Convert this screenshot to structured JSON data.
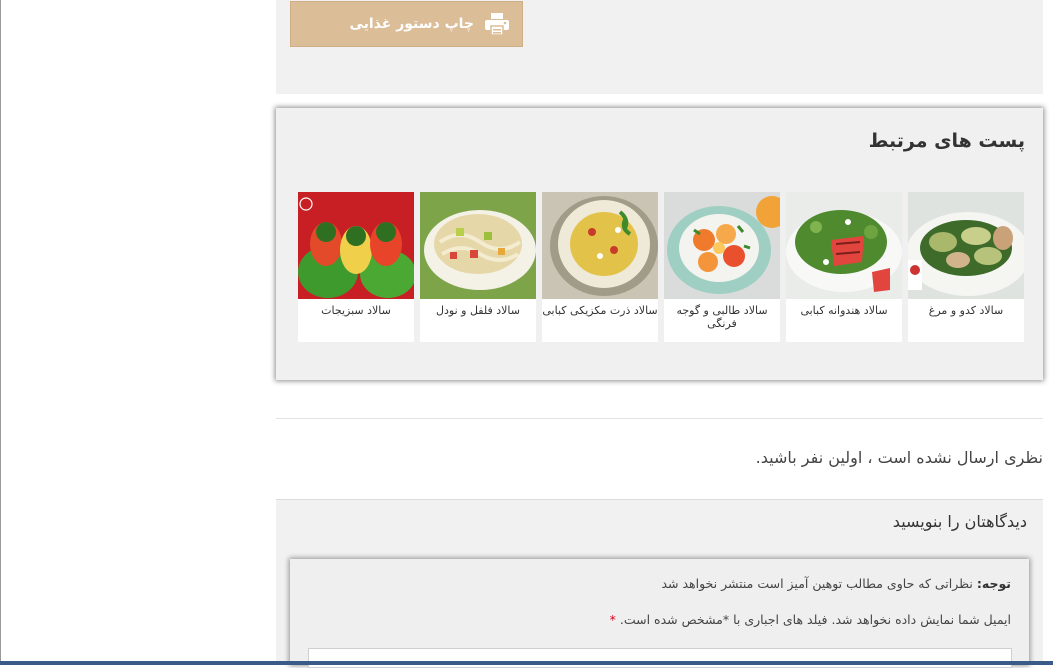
{
  "print_button": {
    "label": "چاپ دستور غذایی",
    "icon": "printer-icon",
    "bg_color": "#dbbd97"
  },
  "related": {
    "title": "پست های مرتبط",
    "items": [
      {
        "label": "سالاد کدو و مرغ"
      },
      {
        "label": "سالاد هندوانه کبابی"
      },
      {
        "label": "سالاد طالبی و گوجه فرنگی"
      },
      {
        "label": "سالاد ذرت مکزیکی کبابی"
      },
      {
        "label": "سالاد فلفل و نودل"
      },
      {
        "label": "سالاد سبزیجات"
      }
    ]
  },
  "comments": {
    "empty_message": "نظری ارسال نشده است ، اولین نفر باشید.",
    "form_title": "دیدگاهتان را بنویسید",
    "notice_label": "توجه:",
    "notice_text": " نظراتی که حاوی مطالب توهین آمیز است منتشر نخواهد شد",
    "email_note": "ایمیل شما نمایش داده نخواهد شد. فیلد های اجباری با *مشخص شده است.",
    "required_mark": "*"
  }
}
